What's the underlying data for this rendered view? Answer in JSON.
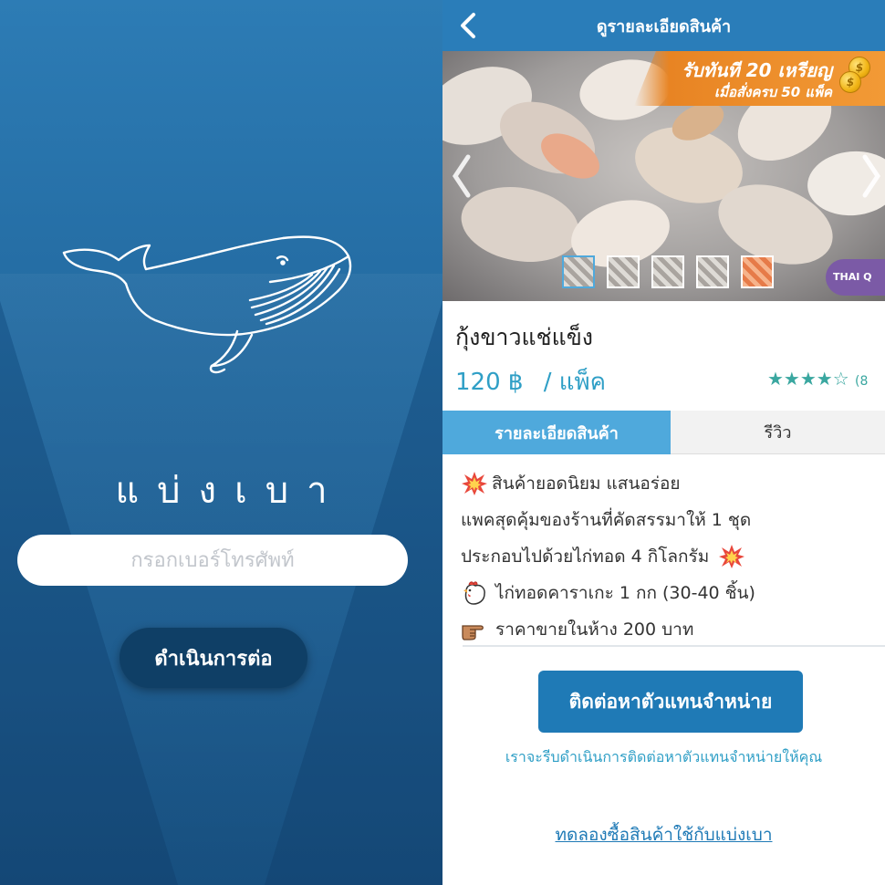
{
  "login": {
    "brand_name": "แบ่งเบา",
    "phone_placeholder": "กรอกเบอร์โทรศัพท์",
    "phone_value": "",
    "continue_label": "ดำเนินการต่อ",
    "colors": {
      "background": "#21679d",
      "button": "#0f3f66"
    }
  },
  "product_page": {
    "nav_title": "ดูรายละเอียดสินค้า",
    "back_icon": "chevron-left-icon",
    "promo": {
      "line1": "รับทันที 20 เหรียญ",
      "line2": "เมื่อสั่งครบ 50 แพ็ค",
      "coin_symbol": "$"
    },
    "carousel": {
      "thumbnail_count": 5,
      "active_index": 0,
      "badge": "THAI Q"
    },
    "product": {
      "name": "กุ้งขาวแช่แข็ง",
      "price": "120 ฿",
      "unit": "/ แพ็ค",
      "rating_stars": "★★★★☆",
      "rating_value": 4,
      "rating_count": "(8"
    },
    "tabs": [
      {
        "label": "รายละเอียดสินค้า",
        "active": true
      },
      {
        "label": "รีวิว",
        "active": false
      }
    ],
    "description": [
      {
        "icon": "explosion-icon",
        "text": "สินค้ายอดนิยม แสนอร่อย"
      },
      {
        "icon": "",
        "text": "แพคสุดคุ้มของร้านที่คัดสรรมาให้ 1 ชุด"
      },
      {
        "icon": "",
        "text": "ประกอบไปด้วยไก่ทอด 4 กิโลกรัม",
        "trailing_icon": "explosion-icon"
      },
      {
        "icon": "chicken-icon",
        "text": "ไก่ทอดคาราเกะ 1 กก (30-40 ชิ้น)"
      },
      {
        "icon": "pointing-hand-icon",
        "text": "ราคาขายในห้าง 200 บาท"
      }
    ],
    "contact_button": "ติดต่อหาตัวแทนจำหน่าย",
    "contact_note": "เราจะรีบดำเนินการติดต่อหาตัวแทนจำหน่ายให้คุณ",
    "trial_link": "ทดลองซื้อสินค้าใช้กับแบ่งเบา",
    "colors": {
      "nav": "#2a7db9",
      "accent": "#2f9fc6",
      "tab_active": "#4fa9dc",
      "star": "#3aa7a0",
      "promo": "#e88423"
    }
  }
}
